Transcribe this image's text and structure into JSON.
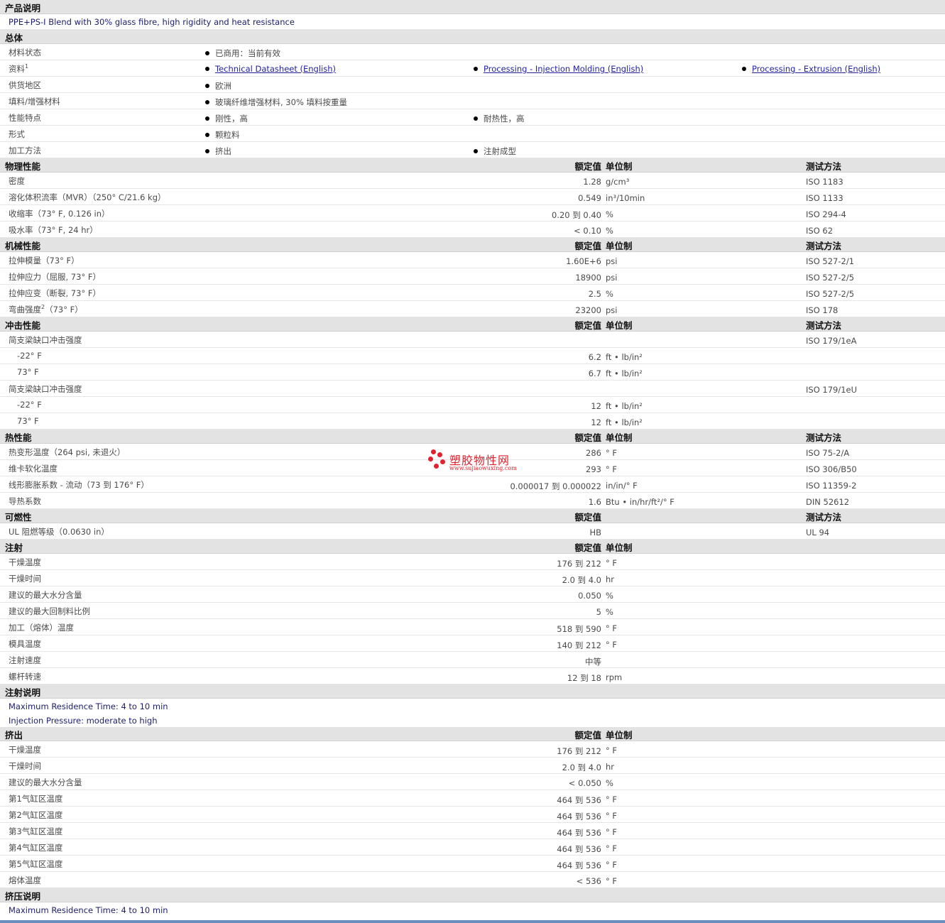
{
  "description": {
    "title": "产品说明",
    "text": "PPE+PS-I Blend with 30% glass fibre, high rigidity and heat resistance"
  },
  "general": {
    "title": "总体",
    "rows": [
      {
        "label": "材料状态",
        "items": [
          "已商用：当前有效"
        ]
      },
      {
        "label": "资料",
        "sup": "1",
        "items": [
          "Technical Datasheet (English)",
          "Processing - Injection Molding (English)",
          "Processing - Extrusion (English)"
        ],
        "links": true
      },
      {
        "label": "供货地区",
        "items": [
          "欧洲"
        ]
      },
      {
        "label": "填料/增强材料",
        "items": [
          "玻璃纤维增强材料, 30% 填料按重量"
        ]
      },
      {
        "label": "性能特点",
        "items": [
          "刚性，高",
          "耐热性，高"
        ]
      },
      {
        "label": "形式",
        "items": [
          "颗粒料"
        ]
      },
      {
        "label": "加工方法",
        "items": [
          "挤出",
          "注射成型"
        ]
      }
    ]
  },
  "headers": {
    "value": "额定值",
    "unit": "单位制",
    "test": "测试方法"
  },
  "physical": {
    "title": "物理性能",
    "rows": [
      {
        "prop": "密度",
        "value": "1.28",
        "unit": "g/cm³",
        "test": "ISO 1183"
      },
      {
        "prop": "溶化体积流率（MVR）（250° C/21.6 kg）",
        "value": "0.549",
        "unit": "in³/10min",
        "test": "ISO 1133"
      },
      {
        "prop": "收缩率（73° F, 0.126 in）",
        "value": "0.20 到  0.40",
        "unit": "%",
        "test": "ISO 294-4"
      },
      {
        "prop": "吸水率（73° F, 24 hr）",
        "value": "< 0.10",
        "unit": "%",
        "test": "ISO 62"
      }
    ]
  },
  "mechanical": {
    "title": "机械性能",
    "rows": [
      {
        "prop": "拉伸模量（73° F）",
        "value": "1.60E+6",
        "unit": "psi",
        "test": "ISO 527-2/1"
      },
      {
        "prop": "拉伸应力（屈服, 73° F）",
        "value": "18900",
        "unit": "psi",
        "test": "ISO 527-2/5"
      },
      {
        "prop": "拉伸应变（断裂, 73° F）",
        "value": "2.5",
        "unit": "%",
        "test": "ISO 527-2/5"
      },
      {
        "prop": "弯曲强度",
        "sup": "2",
        "prop_tail": "（73° F）",
        "value": "23200",
        "unit": "psi",
        "test": "ISO 178"
      }
    ]
  },
  "impact": {
    "title": "冲击性能",
    "rows": [
      {
        "prop": "简支梁缺口冲击强度",
        "value": "",
        "unit": "",
        "test": "ISO 179/1eA"
      },
      {
        "prop": "-22° F",
        "sub": true,
        "value": "6.2",
        "unit": "ft • lb/in²",
        "test": ""
      },
      {
        "prop": "73° F",
        "sub": true,
        "value": "6.7",
        "unit": "ft • lb/in²",
        "test": ""
      },
      {
        "prop": "简支梁缺口冲击强度",
        "value": "",
        "unit": "",
        "test": "ISO 179/1eU"
      },
      {
        "prop": "-22° F",
        "sub": true,
        "value": "12",
        "unit": "ft • lb/in²",
        "test": ""
      },
      {
        "prop": "73° F",
        "sub": true,
        "value": "12",
        "unit": "ft • lb/in²",
        "test": ""
      }
    ]
  },
  "thermal": {
    "title": "热性能",
    "rows": [
      {
        "prop": "热变形温度（264 psi, 未退火）",
        "value": "286",
        "unit": "° F",
        "test": "ISO 75-2/A"
      },
      {
        "prop": "维卡软化温度",
        "value": "293",
        "unit": "° F",
        "test": "ISO 306/B50"
      },
      {
        "prop": "线形膨胀系数 - 流动（73 到  176° F）",
        "value": "0.000017 到  0.000022",
        "unit": "in/in/° F",
        "test": "ISO 11359-2"
      },
      {
        "prop": "导热系数",
        "value": "1.6",
        "unit": "Btu • in/hr/ft²/° F",
        "test": "DIN 52612"
      }
    ]
  },
  "flammability": {
    "title": "可燃性",
    "rows": [
      {
        "prop": "UL 阻燃等级（0.0630 in）",
        "value": "HB",
        "unit": "",
        "test": "UL 94"
      }
    ]
  },
  "injection": {
    "title": "注射",
    "rows": [
      {
        "prop": "干燥温度",
        "value": "176 到  212",
        "unit": "° F"
      },
      {
        "prop": "干燥时间",
        "value": "2.0 到  4.0",
        "unit": "hr"
      },
      {
        "prop": "建议的最大水分含量",
        "value": "0.050",
        "unit": "%"
      },
      {
        "prop": "建议的最大回制料比例",
        "value": "5",
        "unit": "%"
      },
      {
        "prop": "加工（熔体）温度",
        "value": "518 到  590",
        "unit": "° F"
      },
      {
        "prop": "模具温度",
        "value": "140 到  212",
        "unit": "° F"
      },
      {
        "prop": "注射速度",
        "value": "中等",
        "unit": ""
      },
      {
        "prop": "螺杆转速",
        "value": "12 到  18",
        "unit": "rpm"
      }
    ]
  },
  "injection_notes": {
    "title": "注射说明",
    "lines": [
      "Maximum Residence Time: 4 to 10 min",
      "Injection Pressure: moderate to high"
    ]
  },
  "extrusion": {
    "title": "挤出",
    "rows": [
      {
        "prop": "干燥温度",
        "value": "176 到  212",
        "unit": "° F"
      },
      {
        "prop": "干燥时间",
        "value": "2.0 到  4.0",
        "unit": "hr"
      },
      {
        "prop": "建议的最大水分含量",
        "value": "< 0.050",
        "unit": "%"
      },
      {
        "prop": "第1气缸区温度",
        "value": "464 到  536",
        "unit": "° F"
      },
      {
        "prop": "第2气缸区温度",
        "value": "464 到  536",
        "unit": "° F"
      },
      {
        "prop": "第3气缸区温度",
        "value": "464 到  536",
        "unit": "° F"
      },
      {
        "prop": "第4气缸区温度",
        "value": "464 到  536",
        "unit": "° F"
      },
      {
        "prop": "第5气缸区温度",
        "value": "464 到  536",
        "unit": "° F"
      },
      {
        "prop": "熔体温度",
        "value": "< 536",
        "unit": "° F"
      }
    ]
  },
  "extrusion_notes": {
    "title": "挤压说明",
    "lines": [
      "Maximum Residence Time: 4 to 10 min"
    ]
  },
  "watermark": {
    "title": "塑胶物性网",
    "url": "www.sujiaowuxing.com",
    "color": "#e0232e"
  }
}
